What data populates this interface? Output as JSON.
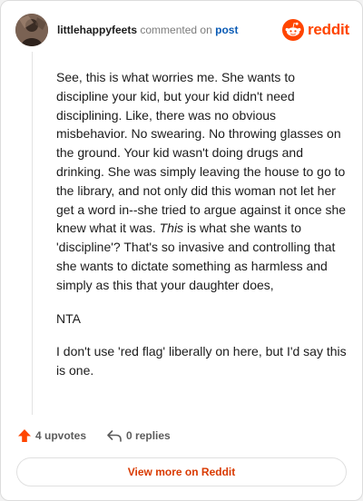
{
  "header": {
    "author": "littlehappyfeets",
    "action_text": "commented on",
    "post_link": "post",
    "logo_text": "reddit"
  },
  "comment": {
    "paragraph1_part1": "See, this is what worries me. She wants to discipline your kid, but your kid didn't need disciplining. Like, there was no obvious misbehavior. No swearing. No throwing glasses on the ground. Your kid wasn't doing drugs and drinking. She was simply leaving the house to go to the library, and not only did this woman not let her get a word in--she tried to argue against it once she knew what it was. ",
    "paragraph1_emphasis": "This",
    "paragraph1_part2": " is what she wants to 'discipline'? That's so invasive and controlling that she wants to dictate something as harmless and simply as this that your daughter does,",
    "paragraph2": "NTA",
    "paragraph3": "I don't use 'red flag' liberally on here, but I'd say this is one."
  },
  "stats": {
    "upvotes_label": "4 upvotes",
    "replies_label": "0 replies"
  },
  "footer": {
    "view_more_label": "View more on Reddit"
  },
  "colors": {
    "brand": "#ff4500",
    "link": "#0a5bb5",
    "view_more": "#d93a00",
    "upvote_arrow": "#ff4500"
  },
  "icons": {
    "logo": "reddit-snoo-icon",
    "upvote": "upvote-arrow-icon",
    "reply": "reply-arrow-icon"
  }
}
